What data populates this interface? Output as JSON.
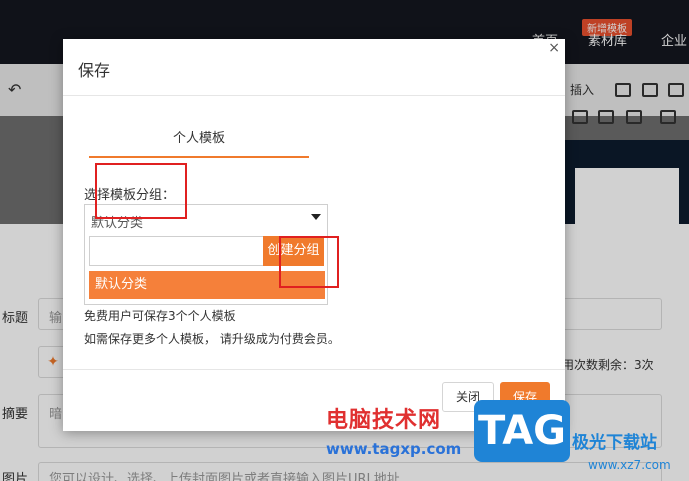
{
  "background": {
    "nav": [
      "首页",
      "素材库",
      "企业"
    ],
    "nav_badge": "新增模板",
    "toolbar_insert": "插入",
    "form": {
      "title_label": "标题",
      "title_placeholder": "输",
      "summary_label": "摘要",
      "summary_placeholder": "暗",
      "cover_label": "图片",
      "cover_hint": "您可以设计、选择、上传封面图片或者直接输入图片URL地址",
      "remaining_text": "用次数剩余：3次"
    }
  },
  "modal": {
    "title": "保存",
    "close_symbol": "×",
    "tab_label": "个人模板",
    "group_label": "选择模板分组：",
    "selected_group": "默认分类",
    "create_group_button": "创建分组",
    "option_default": "默认分类",
    "hint_line1": "免费用户可保存3个个人模板",
    "hint_line2": "如需保存更多个人模板， 请升级成为付费会员。",
    "close_button": "关闭",
    "save_button": "保存"
  },
  "watermark": {
    "site_name": "电脑技术网",
    "site_url": "www.tagxp.com",
    "logo": "TAG",
    "brand": "极光下载站",
    "brand_url": "www.xz7.com"
  },
  "colors": {
    "accent": "#f07a2c",
    "highlight_box": "#e02020"
  }
}
